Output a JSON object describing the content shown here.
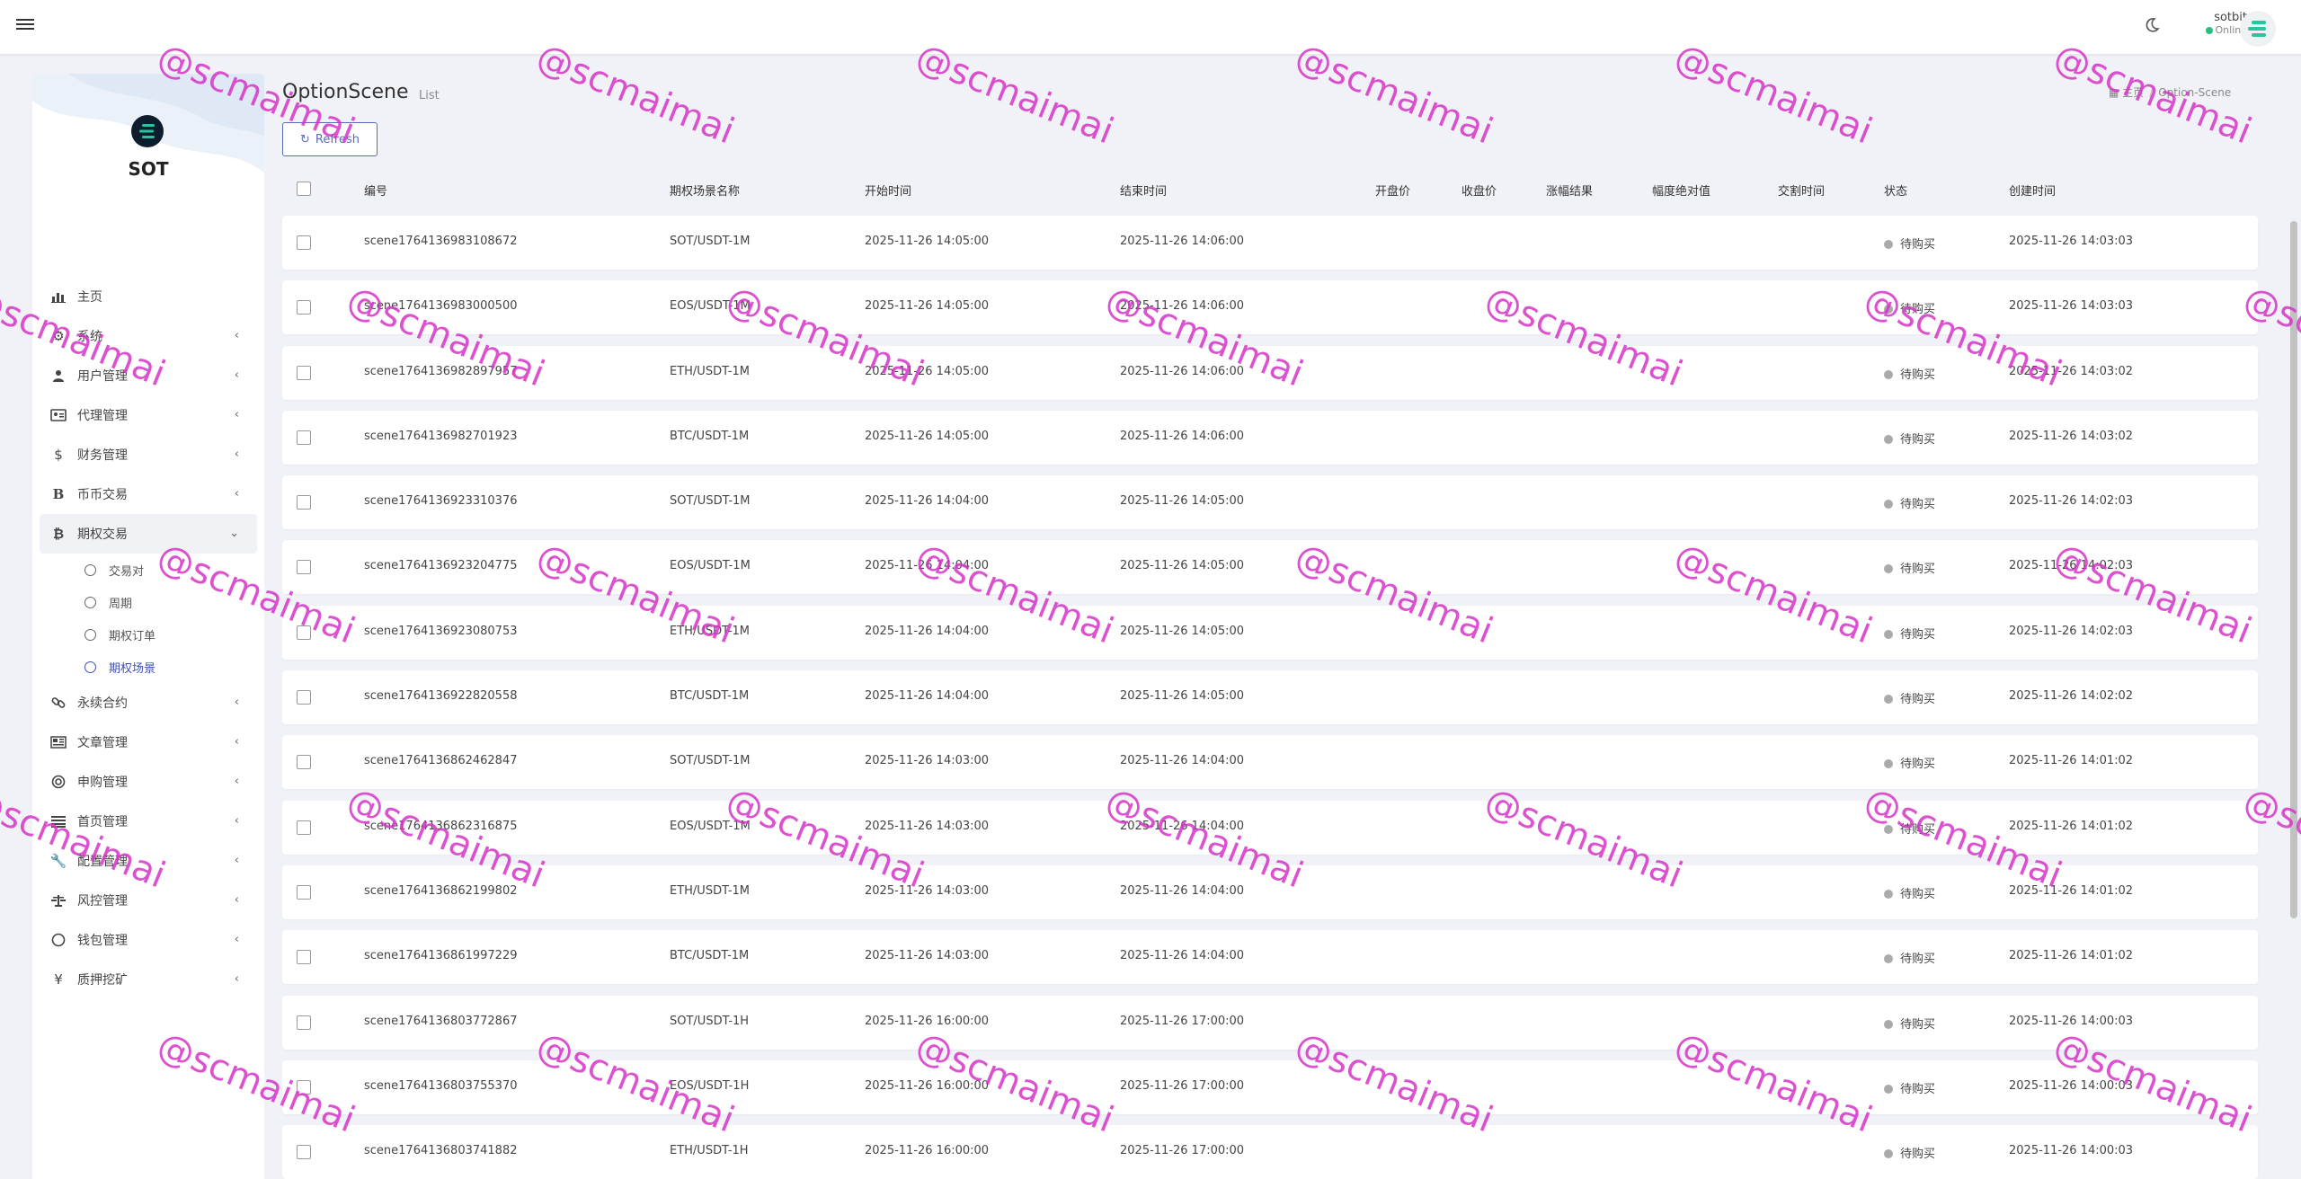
{
  "header": {
    "user_name": "sotbit",
    "user_status": "Online"
  },
  "brand": {
    "name": "SOT"
  },
  "sidebar": {
    "items": [
      {
        "label": "主页",
        "icon": "chart-bar-icon",
        "has_children": false
      },
      {
        "label": "系统",
        "icon": "gear-icon",
        "has_children": true
      },
      {
        "label": "用户管理",
        "icon": "users-icon",
        "has_children": true
      },
      {
        "label": "代理管理",
        "icon": "id-card-icon",
        "has_children": true
      },
      {
        "label": "财务管理",
        "icon": "dollar-icon",
        "has_children": true
      },
      {
        "label": "币币交易",
        "icon": "bitcoin-b-icon",
        "has_children": true
      },
      {
        "label": "期权交易",
        "icon": "bitcoin-icon",
        "has_children": true,
        "open": true
      },
      {
        "label": "永续合约",
        "icon": "link-icon",
        "has_children": true
      },
      {
        "label": "文章管理",
        "icon": "newspaper-icon",
        "has_children": true
      },
      {
        "label": "申购管理",
        "icon": "lifebuoy-icon",
        "has_children": true
      },
      {
        "label": "首页管理",
        "icon": "list-icon",
        "has_children": true
      },
      {
        "label": "配置管理",
        "icon": "wrench-icon",
        "has_children": true
      },
      {
        "label": "风控管理",
        "icon": "balance-icon",
        "has_children": true
      },
      {
        "label": "钱包管理",
        "icon": "circle-icon",
        "has_children": true
      },
      {
        "label": "质押挖矿",
        "icon": "yen-icon",
        "has_children": true
      }
    ],
    "sub_items": [
      {
        "label": "交易对",
        "active": false
      },
      {
        "label": "周期",
        "active": false
      },
      {
        "label": "期权订单",
        "active": false
      },
      {
        "label": "期权场景",
        "active": true
      }
    ]
  },
  "page": {
    "title": "OptionScene",
    "subtitle": "List",
    "breadcrumb": [
      "主页",
      "Option-Scene"
    ],
    "refresh_label": "Refresh"
  },
  "table": {
    "columns": [
      "编号",
      "期权场景名称",
      "开始时间",
      "结束时间",
      "开盘价",
      "收盘价",
      "涨幅结果",
      "幅度绝对值",
      "交割时间",
      "状态",
      "创建时间"
    ],
    "rows": [
      {
        "id": "scene1764136983108672",
        "name": "SOT/USDT-1M",
        "start": "2025-11-26 14:05:00",
        "end": "2025-11-26 14:06:00",
        "status": "待购买",
        "created": "2025-11-26 14:03:03"
      },
      {
        "id": "scene1764136983000500",
        "name": "EOS/USDT-1M",
        "start": "2025-11-26 14:05:00",
        "end": "2025-11-26 14:06:00",
        "status": "待购买",
        "created": "2025-11-26 14:03:03"
      },
      {
        "id": "scene1764136982897957",
        "name": "ETH/USDT-1M",
        "start": "2025-11-26 14:05:00",
        "end": "2025-11-26 14:06:00",
        "status": "待购买",
        "created": "2025-11-26 14:03:02"
      },
      {
        "id": "scene1764136982701923",
        "name": "BTC/USDT-1M",
        "start": "2025-11-26 14:05:00",
        "end": "2025-11-26 14:06:00",
        "status": "待购买",
        "created": "2025-11-26 14:03:02"
      },
      {
        "id": "scene1764136923310376",
        "name": "SOT/USDT-1M",
        "start": "2025-11-26 14:04:00",
        "end": "2025-11-26 14:05:00",
        "status": "待购买",
        "created": "2025-11-26 14:02:03"
      },
      {
        "id": "scene1764136923204775",
        "name": "EOS/USDT-1M",
        "start": "2025-11-26 14:04:00",
        "end": "2025-11-26 14:05:00",
        "status": "待购买",
        "created": "2025-11-26 14:02:03"
      },
      {
        "id": "scene1764136923080753",
        "name": "ETH/USDT-1M",
        "start": "2025-11-26 14:04:00",
        "end": "2025-11-26 14:05:00",
        "status": "待购买",
        "created": "2025-11-26 14:02:03"
      },
      {
        "id": "scene1764136922820558",
        "name": "BTC/USDT-1M",
        "start": "2025-11-26 14:04:00",
        "end": "2025-11-26 14:05:00",
        "status": "待购买",
        "created": "2025-11-26 14:02:02"
      },
      {
        "id": "scene1764136862462847",
        "name": "SOT/USDT-1M",
        "start": "2025-11-26 14:03:00",
        "end": "2025-11-26 14:04:00",
        "status": "待购买",
        "created": "2025-11-26 14:01:02"
      },
      {
        "id": "scene1764136862316875",
        "name": "EOS/USDT-1M",
        "start": "2025-11-26 14:03:00",
        "end": "2025-11-26 14:04:00",
        "status": "待购买",
        "created": "2025-11-26 14:01:02"
      },
      {
        "id": "scene1764136862199802",
        "name": "ETH/USDT-1M",
        "start": "2025-11-26 14:03:00",
        "end": "2025-11-26 14:04:00",
        "status": "待购买",
        "created": "2025-11-26 14:01:02"
      },
      {
        "id": "scene1764136861997229",
        "name": "BTC/USDT-1M",
        "start": "2025-11-26 14:03:00",
        "end": "2025-11-26 14:04:00",
        "status": "待购买",
        "created": "2025-11-26 14:01:02"
      },
      {
        "id": "scene1764136803772867",
        "name": "SOT/USDT-1H",
        "start": "2025-11-26 16:00:00",
        "end": "2025-11-26 17:00:00",
        "status": "待购买",
        "created": "2025-11-26 14:00:03"
      },
      {
        "id": "scene1764136803755370",
        "name": "EOS/USDT-1H",
        "start": "2025-11-26 16:00:00",
        "end": "2025-11-26 17:00:00",
        "status": "待购买",
        "created": "2025-11-26 14:00:03"
      },
      {
        "id": "scene1764136803741882",
        "name": "ETH/USDT-1H",
        "start": "2025-11-26 16:00:00",
        "end": "2025-11-26 17:00:00",
        "status": "待购买",
        "created": "2025-11-26 14:00:03"
      }
    ]
  },
  "watermark": {
    "text": "@scmaimai",
    "color": "#d633c8"
  },
  "colors": {
    "accent": "#3f51b5",
    "status_dot": "#aaaaaa",
    "online": "#25c07f"
  }
}
